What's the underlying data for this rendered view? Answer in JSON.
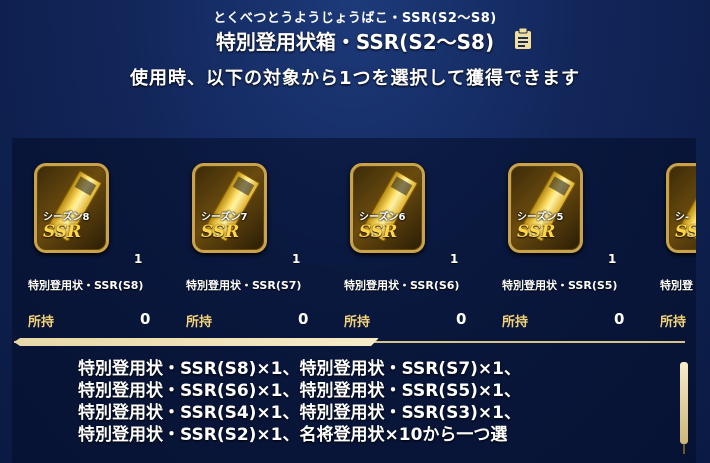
{
  "header": {
    "ruby": "とくべつとうようじょうばこ・SSR(S2〜S8)",
    "title": "特別登用状箱・SSR(S2〜S8)",
    "memo_icon": "memo-icon"
  },
  "subtitle": "使用時、以下の対象から1つを選択して獲得できます",
  "items": [
    {
      "season": "シーズン8",
      "badge": "SSR",
      "qty": "1",
      "name": "特別登用状・SSR(S8)",
      "owned_label": "所持",
      "owned": "0"
    },
    {
      "season": "シーズン7",
      "badge": "SSR",
      "qty": "1",
      "name": "特別登用状・SSR(S7)",
      "owned_label": "所持",
      "owned": "0"
    },
    {
      "season": "シーズン6",
      "badge": "SSR",
      "qty": "1",
      "name": "特別登用状・SSR(S6)",
      "owned_label": "所持",
      "owned": "0"
    },
    {
      "season": "シーズン5",
      "badge": "SSR",
      "qty": "1",
      "name": "特別登用状・SSR(S5)",
      "owned_label": "所持",
      "owned": "0"
    },
    {
      "season": "シ-",
      "badge": "SSR",
      "qty": "",
      "name": "特別登",
      "owned_label": "所持",
      "owned": ""
    }
  ],
  "description": [
    "特別登用状・SSR(S8)×1、特別登用状・SSR(S7)×1、",
    "特別登用状・SSR(S6)×1、特別登用状・SSR(S5)×1、",
    "特別登用状・SSR(S4)×1、特別登用状・SSR(S3)×1、",
    "特別登用状・SSR(S2)×1、名将登用状×10から一つ選"
  ],
  "colors": {
    "accent_gold": "#f2d27a",
    "background": "#12265a",
    "frame": "#caa24a"
  }
}
